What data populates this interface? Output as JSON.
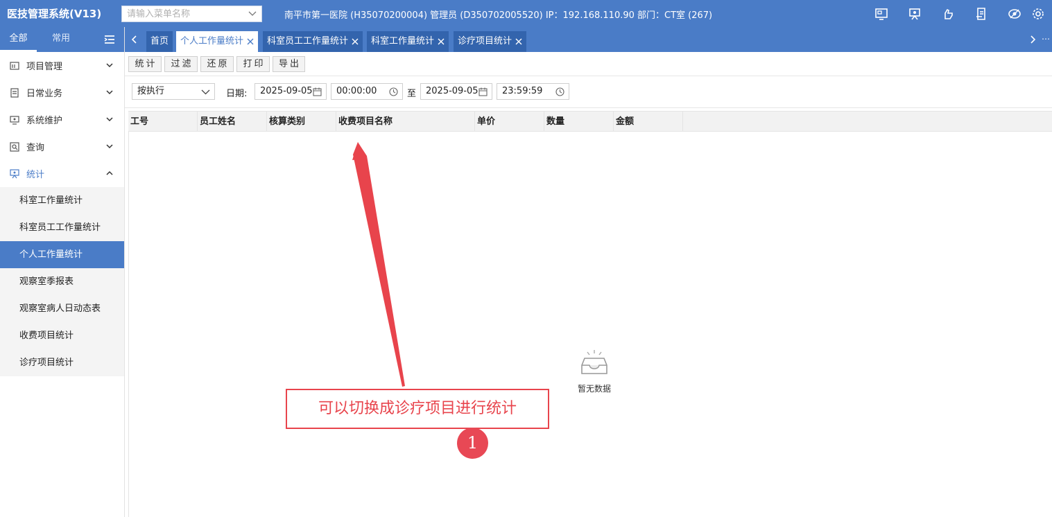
{
  "header": {
    "app_title": "医技管理系统(V13)",
    "menu_search_placeholder": "请输入菜单名称",
    "user_info": "南平市第一医院 (H35070200004) 管理员 (D350702005520) IP：192.168.110.90 部门：CT室 (267)",
    "icons": [
      "monitor-icon",
      "presentation-icon",
      "hand-icon",
      "document-icon",
      "eye-icon",
      "gear-icon"
    ]
  },
  "sidebar": {
    "tab_all": "全部",
    "tab_common": "常用",
    "groups": [
      {
        "label": "项目管理",
        "icon": "project-icon",
        "expanded": false
      },
      {
        "label": "日常业务",
        "icon": "daily-icon",
        "expanded": false
      },
      {
        "label": "系统维护",
        "icon": "system-icon",
        "expanded": false
      },
      {
        "label": "查询",
        "icon": "query-icon",
        "expanded": false
      },
      {
        "label": "统计",
        "icon": "stats-icon",
        "expanded": true
      }
    ],
    "sub_items": [
      "科室工作量统计",
      "科室员工工作量统计",
      "个人工作量统计",
      "观察室季报表",
      "观察室病人日动态表",
      "收费项目统计",
      "诊疗项目统计"
    ],
    "active_sub_item": "个人工作量统计"
  },
  "tabs": [
    {
      "label": "首页",
      "closable": false
    },
    {
      "label": "个人工作量统计",
      "closable": true,
      "active": true
    },
    {
      "label": "科室员工工作量统计",
      "closable": true
    },
    {
      "label": "科室工作量统计",
      "closable": true
    },
    {
      "label": "诊疗项目统计",
      "closable": true
    }
  ],
  "toolbar": {
    "stats": "统计",
    "filter": "过滤",
    "restore": "还原",
    "print": "打印",
    "export": "导出"
  },
  "filters": {
    "mode_value": "按执行",
    "date_label": "日期:",
    "start_date": "2025-09-05",
    "start_time": "00:00:00",
    "to_label": "至",
    "end_date": "2025-09-05",
    "end_time": "23:59:59"
  },
  "grid": {
    "columns": [
      "工号",
      "员工姓名",
      "核算类别",
      "收费项目名称",
      "单价",
      "数量",
      "金额"
    ],
    "rows": [],
    "empty_text": "暂无数据"
  },
  "annotation": {
    "callout_text": "可以切换成诊疗项目进行统计",
    "step_number": "1",
    "color": "#e8444c"
  },
  "colors": {
    "primary": "#4a7cc7",
    "tab_inactive": "#3364ad",
    "annotation_red": "#e8444c"
  }
}
